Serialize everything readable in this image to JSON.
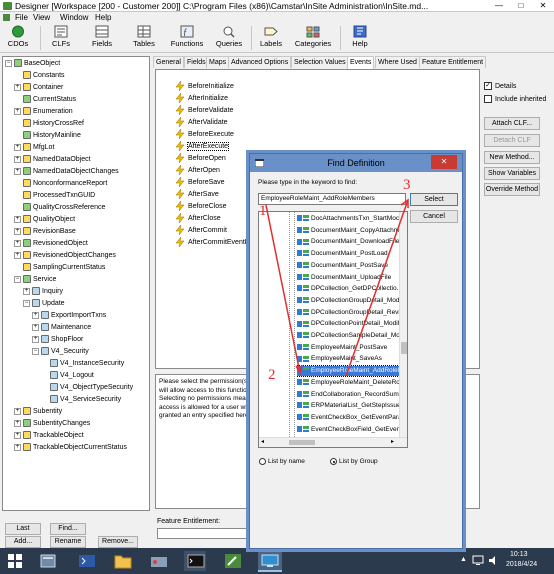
{
  "window": {
    "title": "Designer [Workspace [200 - Customer 200]]  C:\\Program Files (x86)\\Camstar\\InSite Administration\\InSite.md...",
    "minimize": "—",
    "maximize": "□",
    "close": "✕"
  },
  "menu": [
    "File",
    "View",
    "Window",
    "Help"
  ],
  "toolbar": [
    {
      "id": "cdos",
      "label": "CDOs"
    },
    {
      "id": "clfs",
      "label": "CLFs"
    },
    {
      "id": "fields",
      "label": "Fields"
    },
    {
      "id": "tables",
      "label": "Tables"
    },
    {
      "id": "functions",
      "label": "Functions"
    },
    {
      "id": "queries",
      "label": "Queries"
    },
    {
      "id": "labels",
      "label": "Labels"
    },
    {
      "id": "categories",
      "label": "Categories"
    },
    {
      "id": "help",
      "label": "Help"
    }
  ],
  "tree": [
    {
      "label": "BaseObject",
      "toggle": "−",
      "icon": "object-icon"
    },
    {
      "label": "Constants",
      "toggle": "",
      "icon": "object-icon"
    },
    {
      "label": "Container",
      "toggle": "+",
      "icon": "object-icon"
    },
    {
      "label": "CurrentStatus",
      "toggle": "",
      "icon": "object-icon"
    },
    {
      "label": "Enumeration",
      "toggle": "+",
      "icon": "object-icon"
    },
    {
      "label": "HistoryCrossRef",
      "toggle": "",
      "icon": "object-icon"
    },
    {
      "label": "HistoryMainline",
      "toggle": "",
      "icon": "object-icon"
    },
    {
      "label": "MfgLot",
      "toggle": "+",
      "icon": "object-icon"
    },
    {
      "label": "NamedDataObject",
      "toggle": "+",
      "icon": "object-icon"
    },
    {
      "label": "NamedDataObjectChanges",
      "toggle": "+",
      "icon": "object-icon"
    },
    {
      "label": "NonconformanceReport",
      "toggle": "",
      "icon": "object-icon"
    },
    {
      "label": "ProcessedTxnGUID",
      "toggle": "",
      "icon": "object-icon"
    },
    {
      "label": "QualityCrossReference",
      "toggle": "",
      "icon": "object-icon"
    },
    {
      "label": "QualityObject",
      "toggle": "+",
      "icon": "object-icon"
    },
    {
      "label": "RevisionBase",
      "toggle": "+",
      "icon": "object-icon"
    },
    {
      "label": "RevisionedObject",
      "toggle": "+",
      "icon": "object-icon"
    },
    {
      "label": "RevisionedObjectChanges",
      "toggle": "+",
      "icon": "object-icon"
    },
    {
      "label": "SamplingCurrentStatus",
      "toggle": "",
      "icon": "object-icon"
    },
    {
      "label": "Service",
      "toggle": "−",
      "icon": "object-icon"
    },
    {
      "label": "Inquiry",
      "toggle": "+",
      "icon": "service-icon"
    },
    {
      "label": "Update",
      "toggle": "−",
      "icon": "service-icon"
    },
    {
      "label": "ExportImportTxns",
      "toggle": "+",
      "icon": "service-icon"
    },
    {
      "label": "Maintenance",
      "toggle": "+",
      "icon": "service-icon"
    },
    {
      "label": "ShopFloor",
      "toggle": "+",
      "icon": "service-icon"
    },
    {
      "label": "V4_Security",
      "toggle": "−",
      "icon": "service-icon"
    },
    {
      "label": "V4_InstanceSecurity",
      "toggle": "",
      "icon": "service-icon"
    },
    {
      "label": "V4_Logout",
      "toggle": "",
      "icon": "service-icon"
    },
    {
      "label": "V4_ObjectTypeSecurity",
      "toggle": "",
      "icon": "service-icon"
    },
    {
      "label": "V4_ServiceSecurity",
      "toggle": "",
      "icon": "service-icon"
    },
    {
      "label": "Subentity",
      "toggle": "+",
      "icon": "object-icon"
    },
    {
      "label": "SubentityChanges",
      "toggle": "+",
      "icon": "object-icon"
    },
    {
      "label": "TrackableObject",
      "toggle": "+",
      "icon": "object-icon"
    },
    {
      "label": "TrackableObjectCurrentStatus",
      "toggle": "+",
      "icon": "object-icon"
    }
  ],
  "left_buttons": {
    "last": "Last",
    "find": "Find...",
    "add": "Add...",
    "rename": "Rename",
    "remove": "Remove..."
  },
  "tabs": [
    "General",
    "Fields",
    "Maps",
    "Advanced Options",
    "Selection Values",
    "Events",
    "Where Used",
    "Feature Entitlement"
  ],
  "events": [
    "BeforeInitialize",
    "AfterInitialize",
    "BeforeValidate",
    "AfterValidate",
    "BeforeExecute",
    "AfterExecute",
    "BeforeOpen",
    "AfterOpen",
    "BeforeSave",
    "AfterSave",
    "BeforeClose",
    "AfterClose",
    "AfterCommit",
    "AfterCommitEventFai..."
  ],
  "right_panel": {
    "details": "Details",
    "include_inherited": "Include inherited",
    "attach_clf": "Attach CLF...",
    "detach_clf": "Detach CLF",
    "new_method": "New Method...",
    "show_variables": "Show Variables",
    "override_method": "Override Method"
  },
  "description": "Please select the permission(s) that will allow access to this function. Selecting no permissions means that access is allowed for a user who is granted an entry specified here.",
  "feature_entitlement_label": "Feature Entitlement:",
  "dialog": {
    "title": "Find Definition",
    "close": "✕",
    "prompt": "Please type in the keyword to find:",
    "keyword": "EmployeeRoleMaint_AddRoleMembers",
    "select_button": "Select",
    "cancel_button": "Cancel",
    "results": [
      "DocAttachmentsTxn_StartMoc...",
      "DocumentMaint_CopyAttachm...",
      "DocumentMaint_DownloadFile...",
      "DocumentMaint_PostLoad",
      "DocumentMaint_PostSave",
      "DocumentMaint_UploadFile",
      "DPCollection_GetDPCollectio...",
      "DPCollectionGroupDetail_Mod...",
      "DPCollectionGroupDetail_Revi...",
      "DPCollectionPointDetail_Modif...",
      "DPCollectionSampleDetail_Mo...",
      "EmployeeMaint_PostSave",
      "EmployeeMaint_SaveAs",
      "EmployeeRoleMaint_AddRoleM...",
      "EmployeeRoleMaint_DeleteRo...",
      "EndCollaboration_RecordSumr...",
      "ERPMaterialList_GetStepIssue...",
      "EventCheckBox_GetEventPara...",
      "EventCheckBoxField_GetEven..."
    ],
    "selected_index": 13,
    "radio_by_name": "List by name",
    "radio_by_group": "List by Group"
  },
  "annotations": {
    "one": "1",
    "two": "2",
    "three": "3"
  },
  "clock": {
    "time": "10:13",
    "date": "2018/4/24"
  },
  "colors": {
    "accent": "#3b78d8",
    "annotation": "#e03030",
    "taskbar": "#2b3a4c"
  }
}
